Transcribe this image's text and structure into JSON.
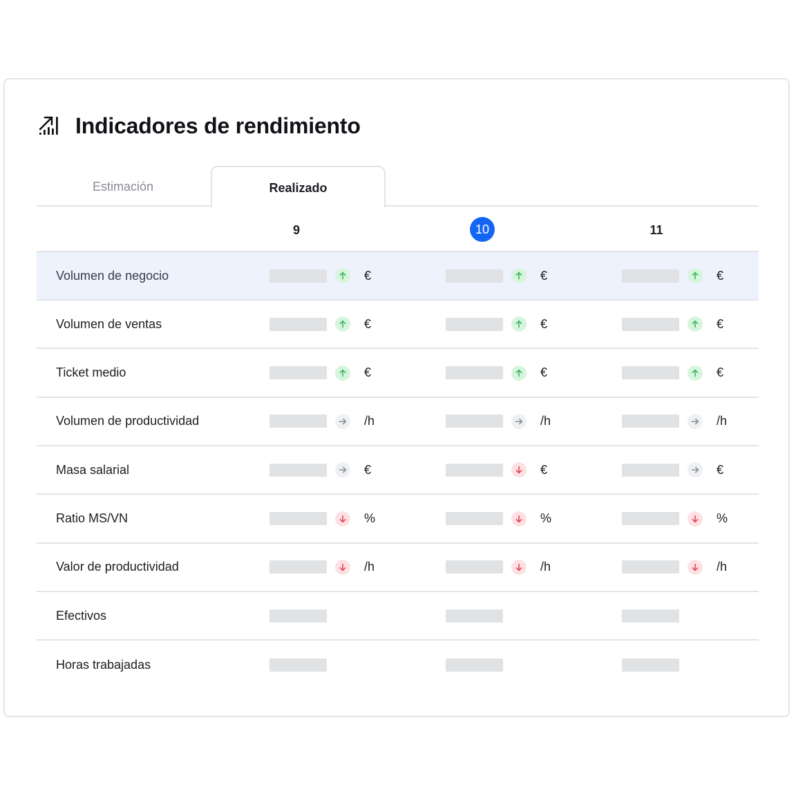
{
  "title": "Indicadores de rendimiento",
  "tabs": [
    {
      "label": "Estimación",
      "active": false
    },
    {
      "label": "Realizado",
      "active": true
    }
  ],
  "columns": [
    "9",
    "10",
    "11"
  ],
  "active_column": "10",
  "colors": {
    "accent": "#1565f5",
    "up": "#3bb561",
    "down": "#e8425a",
    "flat": "#8a8e99",
    "highlight_row": "#eef2fd"
  },
  "rows": [
    {
      "label": "Volumen de negocio",
      "unit": "€",
      "trends": [
        "up",
        "up",
        "up"
      ],
      "highlight": true
    },
    {
      "label": "Volumen de ventas",
      "unit": "€",
      "trends": [
        "up",
        "up",
        "up"
      ]
    },
    {
      "label": "Ticket medio",
      "unit": "€",
      "trends": [
        "up",
        "up",
        "up"
      ]
    },
    {
      "label": "Volumen de productividad",
      "unit": "/h",
      "trends": [
        "flat",
        "flat",
        "flat"
      ]
    },
    {
      "label": "Masa salarial",
      "unit": "€",
      "trends": [
        "flat",
        "down",
        "flat"
      ]
    },
    {
      "label": "Ratio MS/VN",
      "unit": "%",
      "trends": [
        "down",
        "down",
        "down"
      ]
    },
    {
      "label": "Valor de productividad",
      "unit": "/h",
      "trends": [
        "down",
        "down",
        "down"
      ]
    },
    {
      "label": "Efectivos",
      "unit": "",
      "trends": [
        null,
        null,
        null
      ]
    },
    {
      "label": "Horas trabajadas",
      "unit": "",
      "trends": [
        null,
        null,
        null
      ]
    }
  ]
}
